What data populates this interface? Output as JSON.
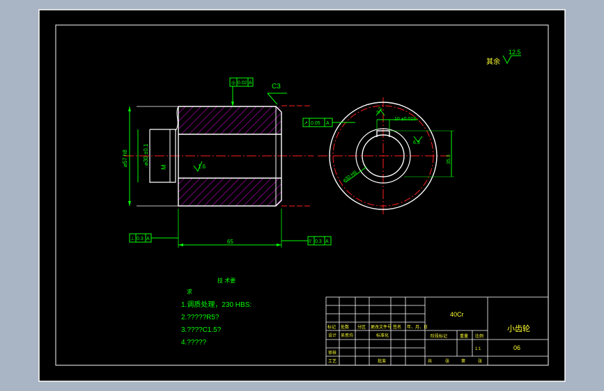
{
  "colors": {
    "background": "#a9b4c4",
    "sheet": "#000000",
    "outline": "#ffffff",
    "dimension": "#00ff00",
    "centerline": "#ff2020",
    "hatch": "#b000b0",
    "yellow": "#ffff33",
    "cyan": "#00ffff"
  },
  "drawing": {
    "surface_finish_label": "其余",
    "surface_finish_value": "12.5",
    "chamfer_label": "C3",
    "tol_top": {
      "symbol": "◎",
      "value": "0.02",
      "datum": "A"
    },
    "tol_runout_mid": {
      "symbol": "↗",
      "value": "0.05",
      "datum": "A"
    },
    "tol_left": {
      "symbol": "⊥",
      "value": "0.3",
      "datum": "A"
    },
    "tol_right": {
      "symbol": "//",
      "value": "0.3",
      "datum": "A"
    },
    "dim_outer_dia": "⌀57 h8",
    "dim_bore_dia": "⌀30 ±0.1",
    "dim_m": "M",
    "dim_length": "65",
    "finish_inner": "1.6",
    "dim_key_width": "10 ±0.018",
    "dim_key_depth": "35.3",
    "finish_key": "6.3",
    "finish_key_top": "3.2",
    "dim_hub_dia": "⌀30 H8"
  },
  "notes": {
    "title": "技 术要",
    "title_cont": "求",
    "items": [
      "1.调质处理，230 HBS:",
      "2.?????R5?",
      "3.????C1.5?",
      "4.?????"
    ]
  },
  "title_block": {
    "material": "40Cr",
    "part_name": "小齿轮",
    "drawing_number": "06",
    "row1_labels": [
      "标记",
      "处数",
      "分区",
      "更改文件号",
      "签名",
      "年、月、日"
    ],
    "design_label": "设计",
    "designer": "吴思均",
    "standard_label": "标准化",
    "review_label": "审核",
    "process_label": "工艺",
    "approve_label": "批准",
    "stage_label": "阶段标记",
    "weight_label": "重量",
    "scale_label": "比例",
    "scale_value": "1:1",
    "sheets_label": [
      "共",
      "张",
      "第",
      "张"
    ]
  }
}
